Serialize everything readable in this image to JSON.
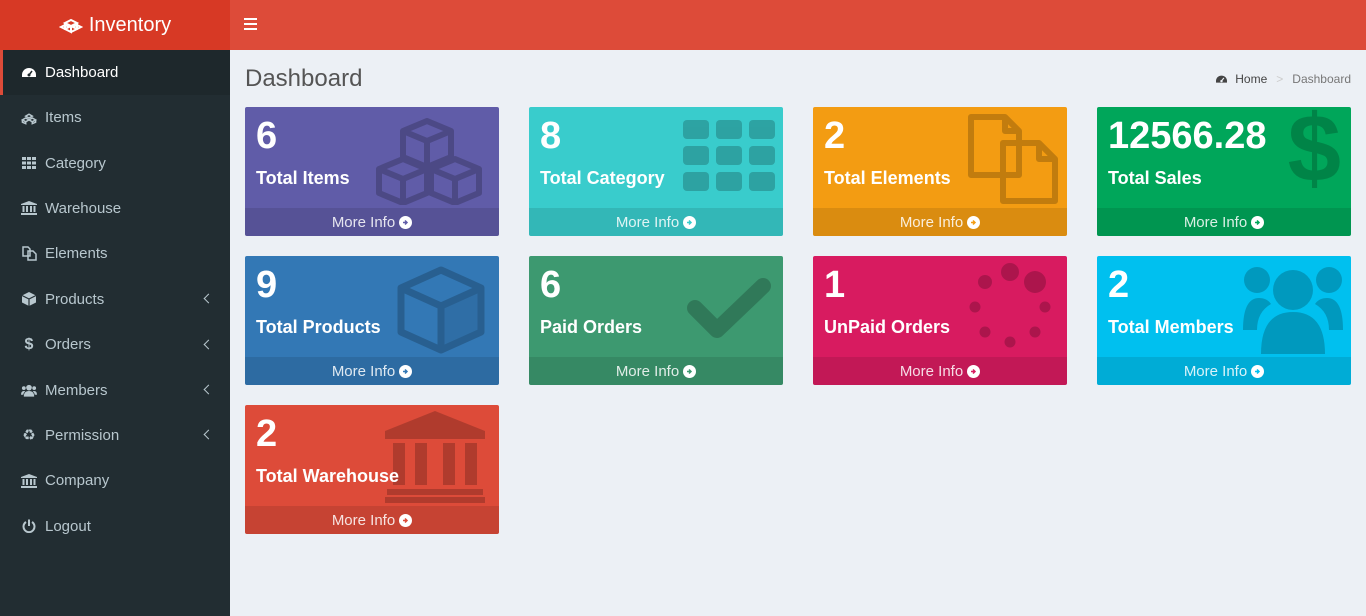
{
  "brand": {
    "title": "Inventory",
    "icon": "cubes-icon"
  },
  "sidebar": {
    "items": [
      {
        "label": "Dashboard",
        "icon": "dashboard-icon",
        "active": true
      },
      {
        "label": "Items",
        "icon": "cubes-icon"
      },
      {
        "label": "Category",
        "icon": "th-icon"
      },
      {
        "label": "Warehouse",
        "icon": "bank-icon"
      },
      {
        "label": "Elements",
        "icon": "files-icon"
      },
      {
        "label": "Products",
        "icon": "cube-icon",
        "expandable": true
      },
      {
        "label": "Orders",
        "icon": "dollar-icon",
        "expandable": true
      },
      {
        "label": "Members",
        "icon": "users-icon",
        "expandable": true
      },
      {
        "label": "Permission",
        "icon": "recycle-icon",
        "expandable": true
      },
      {
        "label": "Company",
        "icon": "bank-icon"
      },
      {
        "label": "Logout",
        "icon": "power-off-icon"
      }
    ]
  },
  "header": {
    "title": "Dashboard"
  },
  "breadcrumb": {
    "home": "Home",
    "separator": ">",
    "current": "Dashboard"
  },
  "boxes": [
    {
      "value": "6",
      "label": "Total Items",
      "footer": "More Info",
      "color": "#605ca8",
      "icon": "cubes-icon"
    },
    {
      "value": "8",
      "label": "Total Category",
      "footer": "More Info",
      "color": "#39cccc",
      "icon": "th-icon"
    },
    {
      "value": "2",
      "label": "Total Elements",
      "footer": "More Info",
      "color": "#f39c12",
      "icon": "files-icon"
    },
    {
      "value": "12566.28",
      "label": "Total Sales",
      "footer": "More Info",
      "color": "#00a65a",
      "icon": "dollar-icon"
    },
    {
      "value": "9",
      "label": "Total Products",
      "footer": "More Info",
      "color": "#3378b5",
      "icon": "cube-icon"
    },
    {
      "value": "6",
      "label": "Paid Orders",
      "footer": "More Info",
      "color": "#3d9970",
      "icon": "check-icon"
    },
    {
      "value": "1",
      "label": "UnPaid Orders",
      "footer": "More Info",
      "color": "#d81b60",
      "icon": "spinner-icon"
    },
    {
      "value": "2",
      "label": "Total Members",
      "footer": "More Info",
      "color": "#00c0ef",
      "icon": "users-icon"
    },
    {
      "value": "2",
      "label": "Total Warehouse",
      "footer": "More Info",
      "color": "#dd4b39",
      "icon": "bank-icon"
    }
  ]
}
